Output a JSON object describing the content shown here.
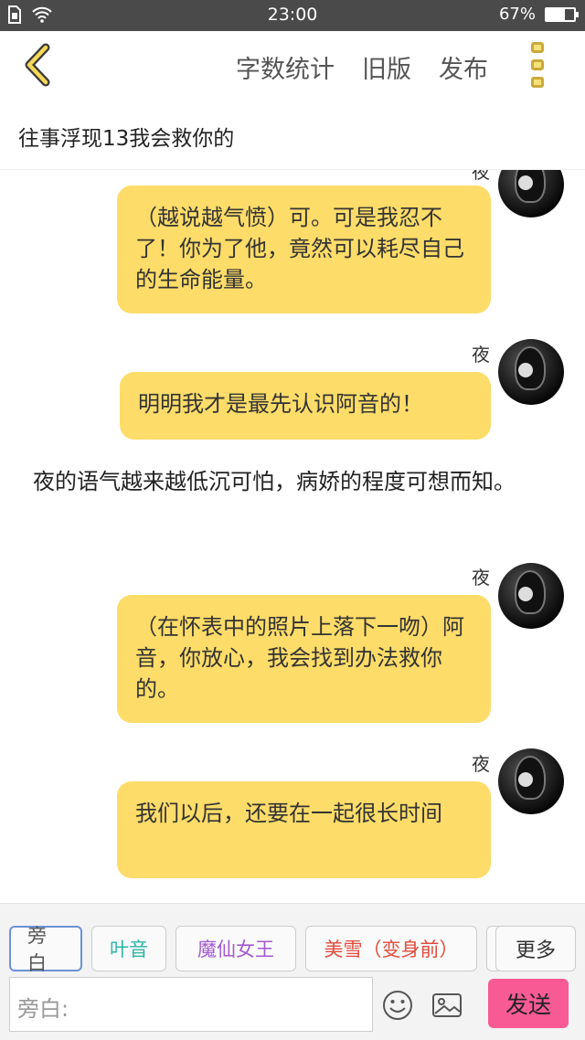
{
  "status": {
    "time": "23:00",
    "battery": "67%",
    "battery_level": 0.67
  },
  "toolbar": {
    "word_count": "字数统计",
    "old_version": "旧版",
    "publish": "发布"
  },
  "title": "往事浮现13我会救你的",
  "messages": [
    {
      "speaker": "夜",
      "text": "（越说越气愤）可。可是我忍不了！你为了他，竟然可以耗尽自己的生命能量。"
    },
    {
      "speaker": "夜",
      "text": "明明我才是最先认识阿音的！"
    },
    {
      "narration": "夜的语气越来越低沉可怕，病娇的程度可想而知。"
    },
    {
      "speaker": "夜",
      "text": "（在怀表中的照片上落下一吻）阿音，你放心，我会找到办法救你的。"
    },
    {
      "speaker": "夜",
      "text": "我们以后，还要在一起很长时间"
    }
  ],
  "roles": [
    {
      "label": "旁白",
      "color": "#555555"
    },
    {
      "label": "叶音",
      "color": "#2bb5a5"
    },
    {
      "label": "魔仙女王",
      "color": "#a45ad0"
    },
    {
      "label": "美雪（变身前）",
      "color": "#e24b3b"
    }
  ],
  "more_roles": "更多",
  "input": {
    "prefix": "旁白:",
    "value": ""
  },
  "send": "发送",
  "colors": {
    "bubble": "#fddc69",
    "send": "#f85b94",
    "status_bar": "#4a4a4a"
  }
}
